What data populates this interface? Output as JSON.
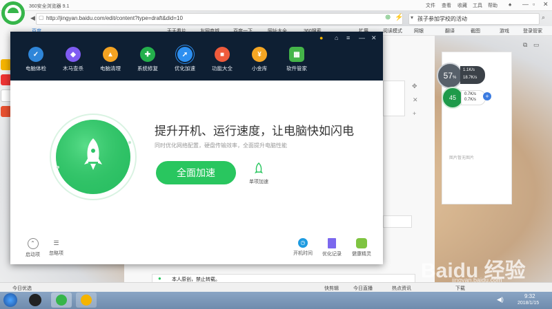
{
  "browser": {
    "title": "360安全浏览器 9.1",
    "menu": [
      "文件",
      "查看",
      "收藏",
      "工具",
      "帮助"
    ],
    "tab_label": "百度",
    "url": "http://jingyan.baidu.com/edit/content?type=draft&did=10",
    "search_text": "孩子参加学校的活动",
    "favorites": [
      "天天看片",
      "友网商城",
      "百度一下",
      "网址大全",
      "360搜索",
      "扩展",
      "阅读模式",
      "网银",
      "翻译",
      "截图",
      "游戏",
      "登录管家"
    ]
  },
  "dialog": {
    "nav": [
      {
        "label": "电脑体检",
        "color": "#2f86d9",
        "glyph": "✓"
      },
      {
        "label": "木马查杀",
        "color": "#7f5cf2",
        "glyph": "◆"
      },
      {
        "label": "电脑清理",
        "color": "#f4a322",
        "glyph": "▲"
      },
      {
        "label": "系统修复",
        "color": "#24b04c",
        "glyph": "✚"
      },
      {
        "label": "优化加速",
        "color": "#2d8ff0",
        "glyph": "➚"
      },
      {
        "label": "功能大全",
        "color": "#ef5b3c",
        "glyph": "■"
      },
      {
        "label": "小金库",
        "color": "#f5a623",
        "glyph": "¥"
      },
      {
        "label": "软件管家",
        "color": "#45b549",
        "glyph": "▦"
      }
    ],
    "headline": "提升开机、运行速度，让电脑快如闪电",
    "subline": "同时优化网络配置，硬盘传输效率，全面提升电脑性能",
    "main_button": "全面加速",
    "single_label": "单项加速",
    "footer_left": [
      "启动项",
      "忽略项"
    ],
    "footer_right": [
      "开机时间",
      "优化记录",
      "健康精灵"
    ]
  },
  "right_panel": {
    "placeholder": "图片暂无图片"
  },
  "meters": {
    "mem_percent": "57",
    "mem_unit": "%",
    "up_speed_1": "1.1K/s",
    "down_speed_1": "18.7K/s",
    "cpu_percent": "45",
    "up_speed_2": "0.7K/s",
    "down_speed_2": "0.7K/s"
  },
  "notice": "本人原创，禁止转载。",
  "statusbar": {
    "left": "今日优选",
    "items": [
      "快剪辑",
      "今日直播",
      "热点资讯",
      "下载"
    ]
  },
  "taskbar": {
    "time": "9:32",
    "date": "2018/1/15"
  },
  "watermark": "Baidu 经验",
  "watermark_url": "jingyan.baidu.com"
}
